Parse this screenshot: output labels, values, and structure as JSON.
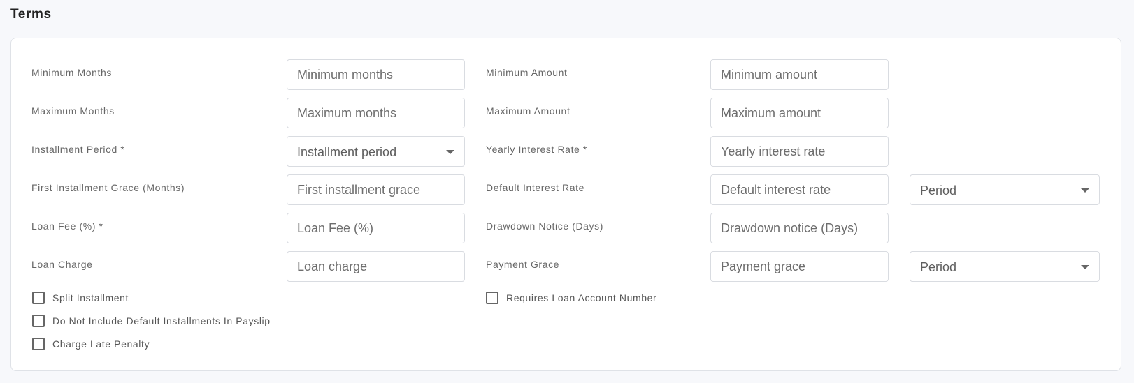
{
  "section": {
    "title": "Terms"
  },
  "fields": {
    "minimum_months": {
      "label": "Minimum Months",
      "placeholder": "Minimum months"
    },
    "maximum_months": {
      "label": "Maximum Months",
      "placeholder": "Maximum months"
    },
    "installment_period": {
      "label": "Installment Period *",
      "value": "Installment period"
    },
    "first_installment_grace": {
      "label": "First Installment Grace (Months)",
      "placeholder": "First installment grace"
    },
    "loan_fee": {
      "label": "Loan Fee (%) *",
      "placeholder": "Loan Fee (%)"
    },
    "loan_charge": {
      "label": "Loan Charge",
      "placeholder": "Loan charge"
    },
    "minimum_amount": {
      "label": "Minimum Amount",
      "placeholder": "Minimum amount"
    },
    "maximum_amount": {
      "label": "Maximum Amount",
      "placeholder": "Maximum amount"
    },
    "yearly_interest_rate": {
      "label": "Yearly Interest Rate *",
      "placeholder": "Yearly interest rate"
    },
    "default_interest_rate": {
      "label": "Default Interest Rate",
      "placeholder": "Default interest rate",
      "period_value": "Period"
    },
    "drawdown_notice": {
      "label": "Drawdown Notice (Days)",
      "placeholder": "Drawdown notice (Days)"
    },
    "payment_grace": {
      "label": "Payment Grace",
      "placeholder": "Payment grace",
      "period_value": "Period"
    }
  },
  "checkboxes": {
    "split_installment": {
      "label": "Split Installment",
      "checked": false
    },
    "do_not_include_default": {
      "label": "Do Not Include Default Installments In Payslip",
      "checked": false
    },
    "charge_late_penalty": {
      "label": "Charge Late Penalty",
      "checked": false
    },
    "requires_loan_account_number": {
      "label": "Requires Loan Account Number",
      "checked": false
    }
  },
  "icons": {
    "dropdown": "caret-down-icon"
  },
  "colors": {
    "background": "#f7f8fb",
    "card": "#ffffff",
    "border": "#d9dce1",
    "text": "#333333"
  }
}
